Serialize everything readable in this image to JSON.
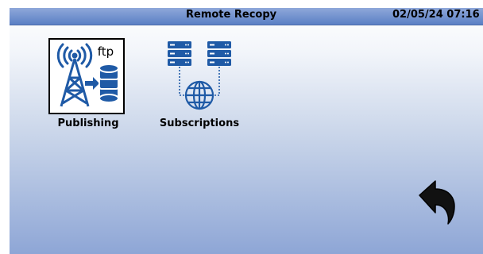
{
  "titlebar": {
    "title": "Remote Recopy",
    "clock": "02/05/24 07:16"
  },
  "apps": [
    {
      "label": "Publishing",
      "badge": "ftp",
      "icon": "ftp-broadcast-tower-icon",
      "selected": true
    },
    {
      "label": "Subscriptions",
      "icon": "network-servers-globe-icon",
      "selected": false
    }
  ],
  "navigation": {
    "back_icon": "back-arrow-icon"
  },
  "colors": {
    "titlebar": "#5a7fc5",
    "icon_blue": "#1f5aa6",
    "background_bottom": "#8ea6d6",
    "selection_border": "#000000"
  }
}
